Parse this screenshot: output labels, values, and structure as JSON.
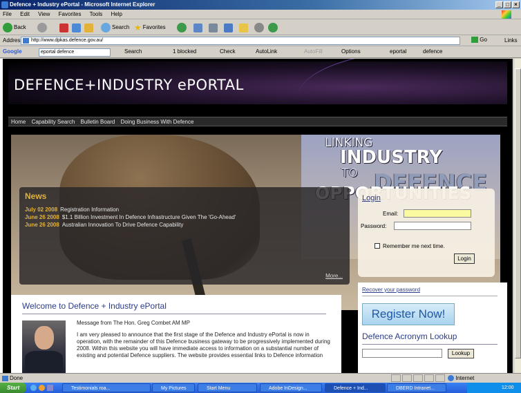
{
  "window": {
    "title": "Defence + Industry ePortal - Microsoft Internet Explorer",
    "controls": [
      "_",
      "□",
      "×"
    ]
  },
  "menu": [
    "File",
    "Edit",
    "View",
    "Favorites",
    "Tools",
    "Help"
  ],
  "toolbar": {
    "back": "Back",
    "search": "Search",
    "favorites": "Favorites"
  },
  "address": {
    "label": "Address",
    "url": "http://www.dpkas.defence.gov.au/",
    "go": "Go",
    "links": "Links"
  },
  "google": {
    "label": "Google",
    "query": "eportal defence",
    "search": "Search",
    "blocked": "1 blocked",
    "check": "Check",
    "autolink": "AutoLink",
    "autofill": "AutoFill",
    "options": "Options",
    "bookmark1": "eportal",
    "bookmark2": "defence"
  },
  "site": {
    "title": "DEFENCE+INDUSTRY ePORTAL",
    "nav": [
      "Home",
      "Capability Search",
      "Bulletin Board",
      "Doing Business With Defence"
    ],
    "tagline": {
      "l1": "LINKING",
      "l2": "INDUSTRY",
      "l3": "TO",
      "l4": "DEFENCE",
      "l5": "OPPORTUNITIES"
    },
    "news": {
      "heading": "News",
      "items": [
        {
          "date": "July 02 2008",
          "text": "Registration Information"
        },
        {
          "date": "June 26 2008",
          "text": "$1.1 Billion Investment In Defence Infrastructure Given The 'Go-Ahead'"
        },
        {
          "date": "June 26 2008",
          "text": "Australian Innovation To Drive Defence Capability"
        }
      ],
      "more": "More..."
    },
    "login": {
      "heading": "Login",
      "email_label": "Email:",
      "password_label": "Password:",
      "remember": "Remember me next time.",
      "button": "Login",
      "recover": "Recover your password"
    },
    "welcome": {
      "heading": "Welcome to Defence + Industry ePortal",
      "message_from": "Message from The Hon. Greg Combet AM MP",
      "paragraph": "I am very pleased to announce that the first stage of the Defence and Industry ePortal is now in operation, with the remainder of this Defence business gateway to be progressively implemented during 2008. Within this website you will have immediate access to information on a substantial number of existing and potential Defence suppliers. The website provides essential links to Defence information"
    },
    "register": "Register Now!",
    "acronym": {
      "heading": "Defence Acronym Lookup",
      "button": "Lookup"
    }
  },
  "status": {
    "text": "Done",
    "zone": "Internet"
  },
  "taskbar": {
    "start": "Start",
    "tasks": [
      "Testimonials roa...",
      "My Pictures",
      "Start Menu",
      "Adobe InDesign...",
      "Defence + Ind...",
      "DBERD Intranet..."
    ],
    "clock": "12:00 PM"
  }
}
